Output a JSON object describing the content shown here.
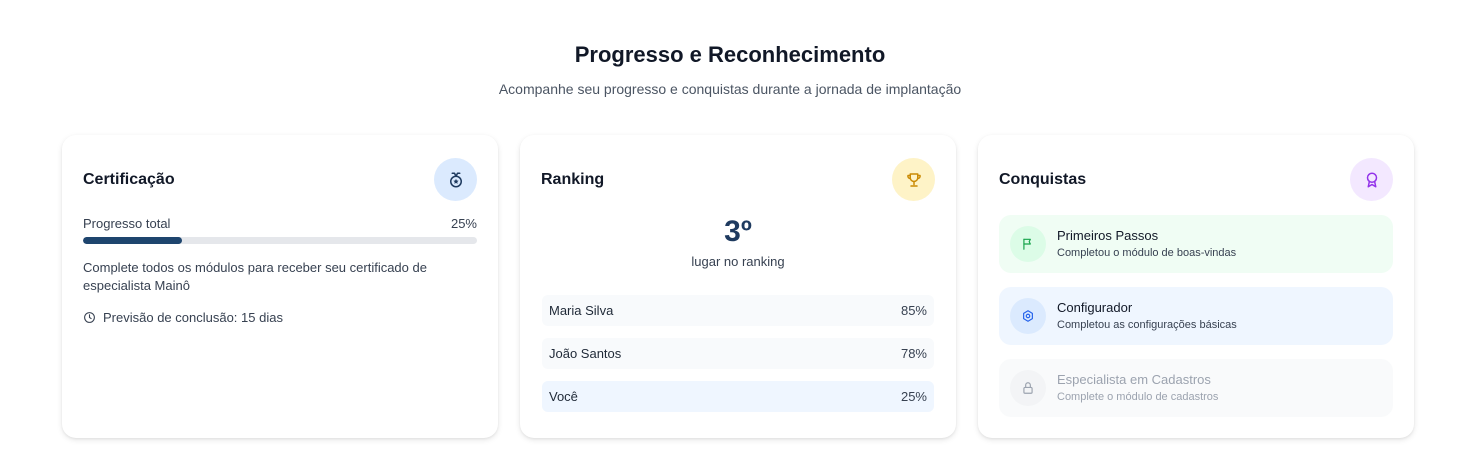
{
  "header": {
    "title": "Progresso e Reconhecimento",
    "subtitle": "Acompanhe seu progresso e conquistas durante a jornada de implantação"
  },
  "certification": {
    "title": "Certificação",
    "icon": "medal-icon",
    "progress_label": "Progresso total",
    "progress_value": "25%",
    "progress_fraction": 0.25,
    "description": "Complete todos os módulos para receber seu certificado de especialista Mainô",
    "eta": "Previsão de conclusão: 15 dias"
  },
  "ranking": {
    "title": "Ranking",
    "icon": "trophy-icon",
    "position": "3º",
    "position_label": "lugar no ranking",
    "rows": [
      {
        "name": "Maria Silva",
        "value": "85%"
      },
      {
        "name": "João Santos",
        "value": "78%"
      },
      {
        "name": "Você",
        "value": "25%"
      }
    ]
  },
  "achievements": {
    "title": "Conquistas",
    "icon": "award-icon",
    "items": [
      {
        "name": "Primeiros Passos",
        "desc": "Completou o módulo de boas-vindas",
        "icon": "flag-icon",
        "state": "done"
      },
      {
        "name": "Configurador",
        "desc": "Completou as configurações básicas",
        "icon": "settings-icon",
        "state": "done"
      },
      {
        "name": "Especialista em Cadastros",
        "desc": "Complete o módulo de cadastros",
        "icon": "lock-icon",
        "state": "locked"
      }
    ]
  },
  "colors": {
    "accent": "#1e456e",
    "cert_icon_bg": "#dbeafe",
    "rank_icon_bg": "#fef3c7",
    "ach_icon_bg": "#f3e8ff",
    "ach_green_bg": "#f0fdf4",
    "ach_blue_bg": "#eff6ff",
    "ach_locked_bg": "#f9fafb"
  }
}
